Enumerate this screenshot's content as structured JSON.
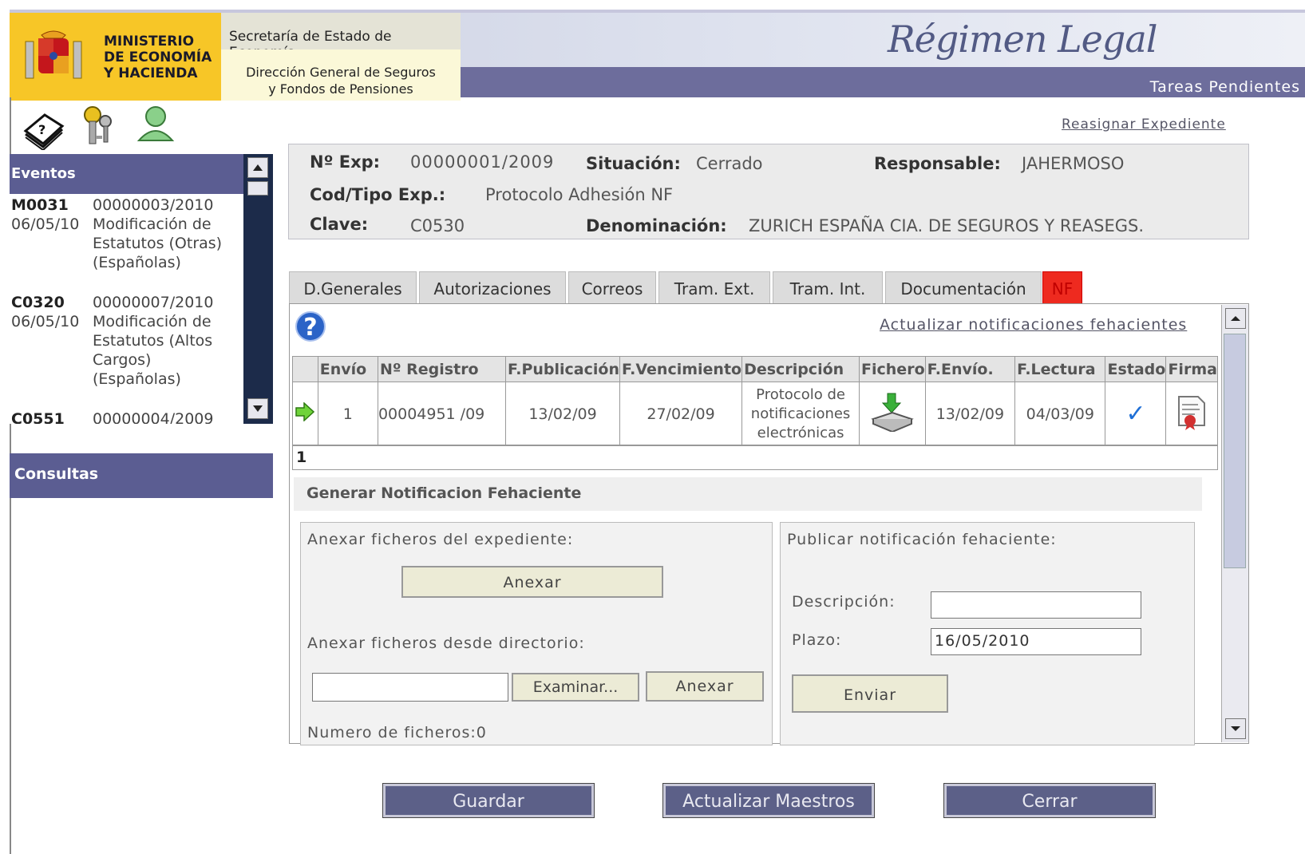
{
  "header": {
    "ministry": "MINISTERIO DE ECONOMÍA Y HACIENDA",
    "ministry_lines": [
      "MINISTERIO",
      "DE ECONOMÍA",
      "Y HACIENDA"
    ],
    "secretaria": "Secretaría de Estado de Economía",
    "direccion_lines": [
      "Dirección General de Seguros",
      "y Fondos de Pensiones"
    ],
    "app_title": "Régimen Legal",
    "app_subtitle": "Tareas Pendientes"
  },
  "toolbar": {
    "icons": [
      "help-book-icon",
      "keys-icon",
      "user-icon"
    ]
  },
  "sidebar": {
    "eventos_title": "Eventos",
    "eventos": [
      {
        "code": "M0031",
        "exp": "00000003/2010",
        "date": "06/05/10",
        "desc_lines": [
          "Modificación de",
          "Estatutos (Otras)",
          "(Españolas)"
        ]
      },
      {
        "code": "C0320",
        "exp": "00000007/2010",
        "date": "06/05/10",
        "desc_lines": [
          "Modificación de",
          "Estatutos (Altos",
          "Cargos)",
          "(Españolas)"
        ]
      },
      {
        "code": "C0551",
        "exp": "00000004/2009",
        "date": "",
        "desc_lines": []
      }
    ],
    "consultas_title": "Consultas"
  },
  "links": {
    "reasignar": "Reasignar Expediente",
    "actualizar": "Actualizar notificaciones fehacientes"
  },
  "expediente": {
    "num_label": "Nº Exp:",
    "num_value": "00000001/2009",
    "situacion_label": "Situación:",
    "situacion_value": "Cerrado",
    "responsable_label": "Responsable:",
    "responsable_value": "JAHERMOSO",
    "tipo_label": "Cod/Tipo Exp.:",
    "tipo_value": "Protocolo Adhesión NF",
    "clave_label": "Clave:",
    "clave_value": "C0530",
    "denominacion_label": "Denominación:",
    "denominacion_value": "ZURICH ESPAÑA CIA. DE SEGUROS Y REASEGS."
  },
  "tabs": [
    "D.Generales",
    "Autorizaciones",
    "Correos",
    "Tram. Ext.",
    "Tram. Int.",
    "Documentación",
    "NF"
  ],
  "active_tab": "NF",
  "table": {
    "headers": [
      "",
      "Envío",
      "Nº Registro",
      "F.Publicación",
      "F.Vencimiento",
      "Descripción",
      "Fichero",
      "F.Envío.",
      "F.Lectura",
      "Estado",
      "Firma"
    ],
    "rows": [
      {
        "envio": "1",
        "registro": "00004951 /09",
        "f_publicacion": "13/02/09",
        "f_vencimiento": "27/02/09",
        "descripcion_lines": [
          "Protocolo de",
          "notificaciones",
          "electrónicas"
        ],
        "f_envio": "13/02/09",
        "f_lectura": "04/03/09",
        "estado": "✓"
      }
    ],
    "pager": "1"
  },
  "generar": {
    "title": "Generar Notificacion Fehaciente",
    "anexar_expediente_label": "Anexar ficheros del expediente:",
    "anexar_button": "Anexar",
    "anexar_directorio_label": "Anexar ficheros desde directorio:",
    "examinar_button": "Examinar...",
    "anexar_button2": "Anexar",
    "numero_ficheros": "Numero de ficheros:0",
    "publicar_label": "Publicar notificación fehaciente:",
    "descripcion_label": "Descripción:",
    "descripcion_value": "",
    "plazo_label": "Plazo:",
    "plazo_value": "16/05/2010",
    "enviar_button": "Enviar"
  },
  "footer": {
    "guardar": "Guardar",
    "actualizar_maestros": "Actualizar Maestros",
    "cerrar": "Cerrar"
  },
  "colors": {
    "header_bar": "#6d6d9c",
    "ministry_yellow": "#f7c627",
    "sidebar_head": "#5b5d92",
    "tab_nf": "#ee2a1f"
  }
}
